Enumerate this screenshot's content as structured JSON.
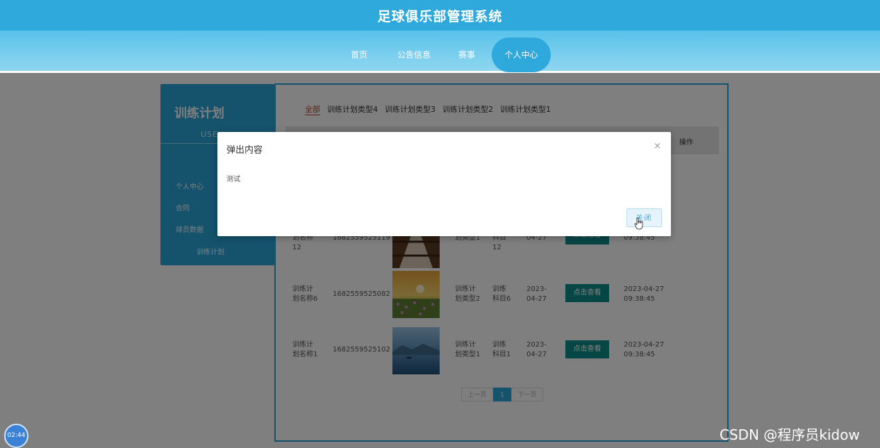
{
  "header": {
    "title": "足球俱乐部管理系统"
  },
  "nav": {
    "items": [
      {
        "label": "首页"
      },
      {
        "label": "公告信息"
      },
      {
        "label": "赛事"
      },
      {
        "label": "个人中心"
      }
    ],
    "active": "个人中心"
  },
  "sidebar": {
    "title": "训练计划",
    "subtitle": "USE",
    "items": [
      {
        "label": "个人中心"
      },
      {
        "label": "合同"
      },
      {
        "label": "球员数据"
      },
      {
        "label": "训练计划"
      }
    ]
  },
  "filters": {
    "tabs": [
      {
        "label": "全部"
      },
      {
        "label": "训练计划类型4"
      },
      {
        "label": "训练计划类型3"
      },
      {
        "label": "训练计划类型2"
      },
      {
        "label": "训练计划类型1"
      }
    ],
    "active": "全部"
  },
  "table": {
    "operation_header": "操作",
    "rows": [
      {
        "name_line1": "划名称",
        "name_line2": "12",
        "number": "1682559525119",
        "type_line1": "",
        "type_line2": "划类型1",
        "subject_line1": "科目",
        "subject_line2": "12",
        "date_line1": "",
        "date_line2": "04-27",
        "button": "点击查看",
        "time_line1": "",
        "time_line2": "09:38:45",
        "image": "corridor-photo"
      },
      {
        "name_line1": "训练计",
        "name_line2": "划名称6",
        "number": "1682559525082",
        "type_line1": "训练计",
        "type_line2": "划类型2",
        "subject_line1": "训练",
        "subject_line2": "科目6",
        "date_line1": "2023-",
        "date_line2": "04-27",
        "button": "点击查看",
        "time_line1": "2023-04-27",
        "time_line2": "09:38:45",
        "image": "sunset-flowers-photo"
      },
      {
        "name_line1": "训练计",
        "name_line2": "划名称1",
        "number": "1682559525102",
        "type_line1": "训练计",
        "type_line2": "划类型1",
        "subject_line1": "训练",
        "subject_line2": "科目1",
        "date_line1": "2023-",
        "date_line2": "04-27",
        "button": "点击查看",
        "time_line1": "2023-04-27",
        "time_line2": "09:38:45",
        "image": "lake-photo"
      }
    ]
  },
  "pagination": {
    "prev": "上一页",
    "current": "1",
    "next": "下一页"
  },
  "dialog": {
    "title": "弹出内容",
    "close_icon": "close-icon",
    "body": "测试",
    "button": "关闭"
  },
  "overlay_clock": "02:44",
  "watermark": "CSDN @程序员kidow",
  "colors": {
    "header_blue": "#2fa8dc",
    "sidebar_blue": "#2aa4d8",
    "view_button": "#0d8f8a",
    "active_tab": "#c0392b"
  }
}
